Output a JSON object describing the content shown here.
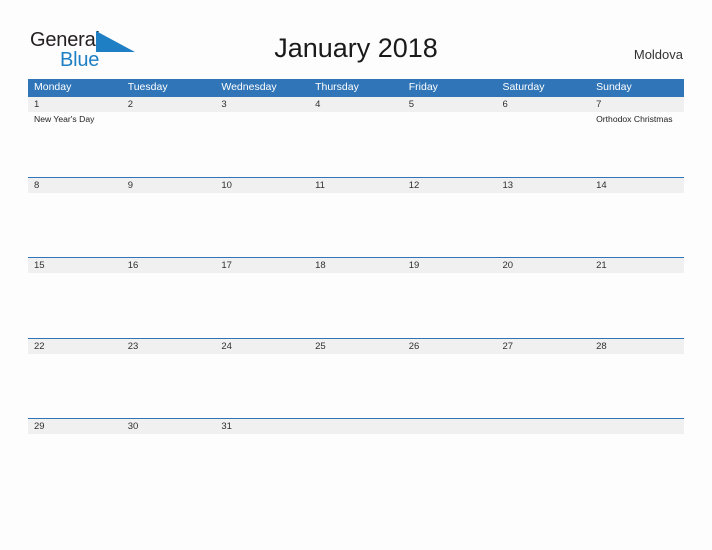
{
  "branding": {
    "logo_text_1": "General",
    "logo_text_2": "Blue",
    "logo_icon": "flag-triangle-icon",
    "logo_color_dark": "#231f20",
    "logo_color_blue": "#1f7fc4"
  },
  "header": {
    "title": "January 2018",
    "country": "Moldova",
    "accent_color": "#3075b8",
    "date_band_color": "#f0f0f0",
    "background_color": "#fdfdfd"
  },
  "calendar": {
    "month": "January",
    "year": "2018",
    "weekday_headers": [
      "Monday",
      "Tuesday",
      "Wednesday",
      "Thursday",
      "Friday",
      "Saturday",
      "Sunday"
    ],
    "weeks": [
      {
        "days": [
          {
            "num": "1",
            "events": [
              "New Year's Day"
            ]
          },
          {
            "num": "2",
            "events": []
          },
          {
            "num": "3",
            "events": []
          },
          {
            "num": "4",
            "events": []
          },
          {
            "num": "5",
            "events": []
          },
          {
            "num": "6",
            "events": []
          },
          {
            "num": "7",
            "events": [
              "Orthodox Christmas"
            ]
          }
        ]
      },
      {
        "days": [
          {
            "num": "8",
            "events": []
          },
          {
            "num": "9",
            "events": []
          },
          {
            "num": "10",
            "events": []
          },
          {
            "num": "11",
            "events": []
          },
          {
            "num": "12",
            "events": []
          },
          {
            "num": "13",
            "events": []
          },
          {
            "num": "14",
            "events": []
          }
        ]
      },
      {
        "days": [
          {
            "num": "15",
            "events": []
          },
          {
            "num": "16",
            "events": []
          },
          {
            "num": "17",
            "events": []
          },
          {
            "num": "18",
            "events": []
          },
          {
            "num": "19",
            "events": []
          },
          {
            "num": "20",
            "events": []
          },
          {
            "num": "21",
            "events": []
          }
        ]
      },
      {
        "days": [
          {
            "num": "22",
            "events": []
          },
          {
            "num": "23",
            "events": []
          },
          {
            "num": "24",
            "events": []
          },
          {
            "num": "25",
            "events": []
          },
          {
            "num": "26",
            "events": []
          },
          {
            "num": "27",
            "events": []
          },
          {
            "num": "28",
            "events": []
          }
        ]
      },
      {
        "days": [
          {
            "num": "29",
            "events": []
          },
          {
            "num": "30",
            "events": []
          },
          {
            "num": "31",
            "events": []
          },
          {
            "num": "",
            "events": []
          },
          {
            "num": "",
            "events": []
          },
          {
            "num": "",
            "events": []
          },
          {
            "num": "",
            "events": []
          }
        ]
      }
    ]
  }
}
